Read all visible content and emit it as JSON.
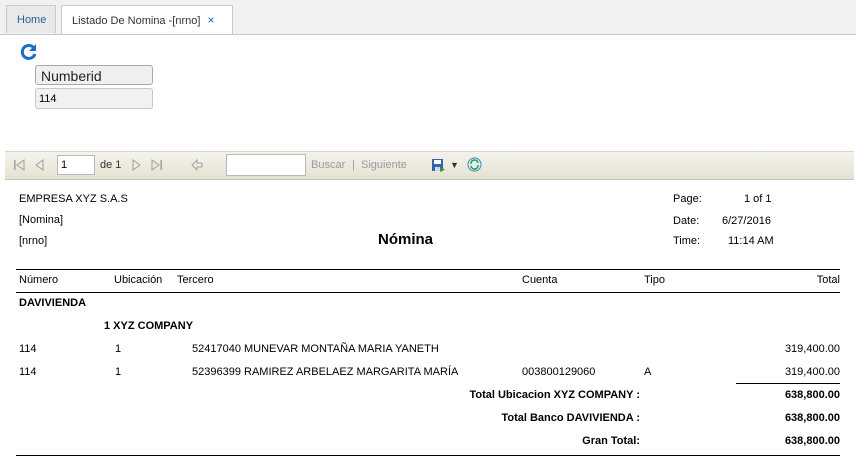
{
  "tabs": {
    "home": "Home",
    "active": "Listado De Nomina -[nrno]",
    "close": "×"
  },
  "params": {
    "label": "Numberid",
    "value": "114"
  },
  "toolbar": {
    "page_value": "1",
    "of_label": "de 1",
    "search_label": "Buscar",
    "separator": "|",
    "next_label": "Siguiente"
  },
  "report": {
    "company": "EMPRESA XYZ S.A.S",
    "sub1": "[Nomina]",
    "sub2": "[nrno]",
    "title": "Nómina",
    "page_label": "Page:",
    "page_value": "1 of 1",
    "date_label": "Date:",
    "date_value": "6/27/2016",
    "time_label": "Time:",
    "time_value": "11:14 AM",
    "headers": {
      "numero": "Número",
      "ubicacion": "Ubicación",
      "tercero": "Tercero",
      "cuenta": "Cuenta",
      "tipo": "Tipo",
      "total": "Total"
    },
    "bank": "DAVIVIENDA",
    "location": "1 XYZ COMPANY",
    "rows": [
      {
        "numero": "114",
        "ubicacion": "1",
        "tercero": "52417040 MUNEVAR MONTAÑA MARIA YANETH",
        "cuenta": "",
        "tipo": "",
        "total": "319,400.00"
      },
      {
        "numero": "114",
        "ubicacion": "1",
        "tercero": "52396399 RAMIREZ ARBELAEZ MARGARITA MARÍA",
        "cuenta": "003800129060",
        "tipo": "A",
        "total": "319,400.00"
      }
    ],
    "totals": [
      {
        "label": "Total Ubicacion XYZ COMPANY :",
        "value": "638,800.00"
      },
      {
        "label": "Total Banco DAVIVIENDA :",
        "value": "638,800.00"
      },
      {
        "label": "Gran Total:",
        "value": "638,800.00"
      }
    ]
  },
  "colors": {
    "link": "#15428b",
    "refresh": "#1a6fc4",
    "toolbar": "#e9e6da"
  }
}
